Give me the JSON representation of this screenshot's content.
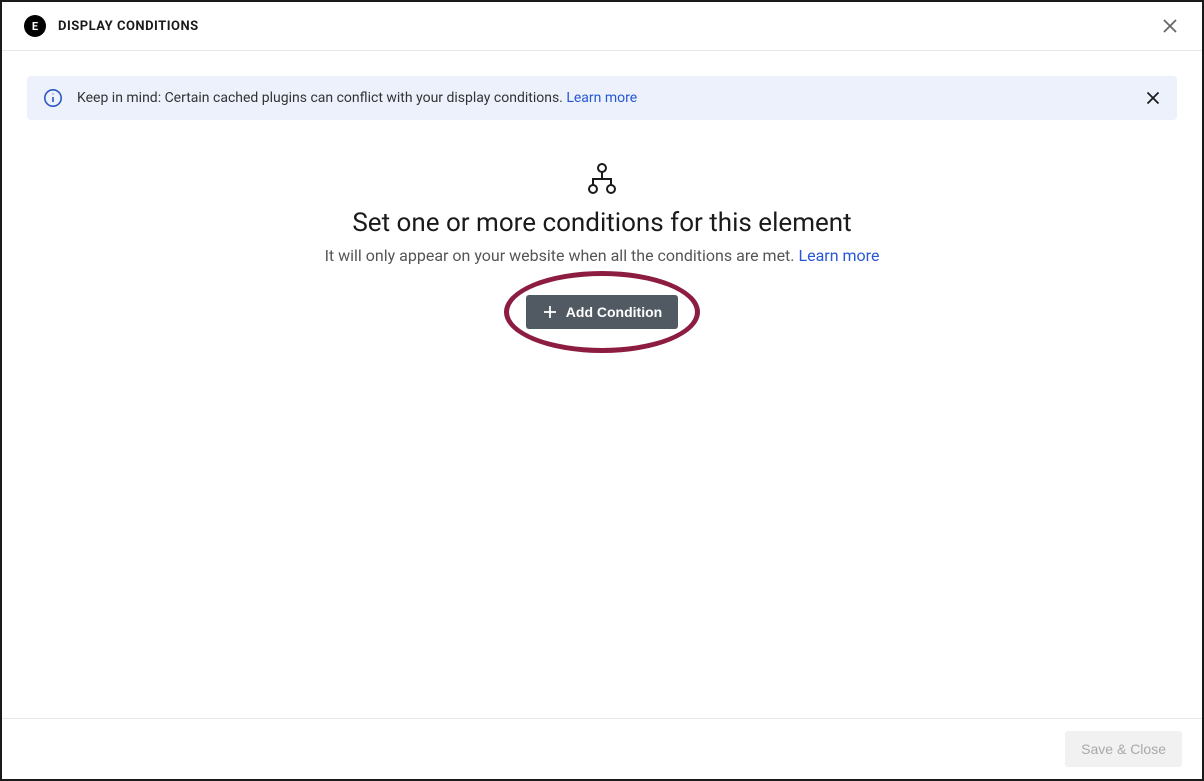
{
  "header": {
    "title": "DISPLAY CONDITIONS"
  },
  "notice": {
    "text": "Keep in mind: Certain cached plugins can conflict with your display conditions. ",
    "link": "Learn more"
  },
  "main": {
    "title": "Set one or more conditions for this element",
    "subtitle_prefix": "It will only appear on your website when all the conditions are met. ",
    "subtitle_link": "Learn more",
    "add_button": "Add Condition"
  },
  "footer": {
    "save_button": "Save & Close"
  }
}
